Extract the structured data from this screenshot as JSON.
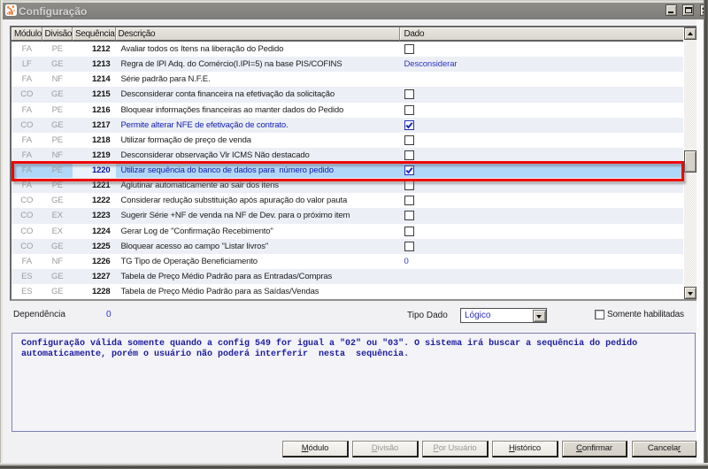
{
  "window": {
    "title": "Configuração",
    "window_buttons": [
      "minimize",
      "maximize",
      "close"
    ]
  },
  "table": {
    "columns": [
      "Módulo",
      "Divisão",
      "Sequência",
      "Descrição",
      "Dado"
    ],
    "rows": [
      {
        "module": "FA",
        "division": "PE",
        "sequence": "1212",
        "description": "Avaliar todos os Itens na liberação do Pedido",
        "dado_type": "checkbox",
        "dado_checked": false,
        "emphasis": false,
        "selected": false
      },
      {
        "module": "LF",
        "division": "GE",
        "sequence": "1213",
        "description": "Regra de IPI Adq. do Comércio(I.IPI=5) na base PIS/COFINS",
        "dado_type": "text",
        "dado_text": "Desconsiderar",
        "emphasis": false,
        "selected": false
      },
      {
        "module": "FA",
        "division": "NF",
        "sequence": "1214",
        "description": "Série padrão para N.F.E.",
        "dado_type": "none",
        "emphasis": false,
        "selected": false
      },
      {
        "module": "CO",
        "division": "GE",
        "sequence": "1215",
        "description": "Desconsiderar conta financeira na efetivação da solicitação",
        "dado_type": "checkbox",
        "dado_checked": false,
        "emphasis": false,
        "selected": false
      },
      {
        "module": "FA",
        "division": "PE",
        "sequence": "1216",
        "description": "Bloquear informações financeiras ao manter dados do Pedido",
        "dado_type": "checkbox",
        "dado_checked": false,
        "emphasis": false,
        "selected": false
      },
      {
        "module": "CO",
        "division": "GE",
        "sequence": "1217",
        "description": "Permite alterar NFE de efetivação de contrato.",
        "dado_type": "checkbox",
        "dado_checked": true,
        "emphasis": true,
        "selected": false
      },
      {
        "module": "FA",
        "division": "PE",
        "sequence": "1218",
        "description": "Utilizar formação de preço de venda",
        "dado_type": "checkbox",
        "dado_checked": false,
        "emphasis": false,
        "selected": false
      },
      {
        "module": "FA",
        "division": "NF",
        "sequence": "1219",
        "description": "Desconsiderar observação Vlr ICMS Não destacado",
        "dado_type": "checkbox",
        "dado_checked": false,
        "emphasis": false,
        "selected": false
      },
      {
        "module": "FA",
        "division": "PE",
        "sequence": "1220",
        "description": "Utilizar sequência do banco de dados para  número pedido",
        "dado_type": "checkbox",
        "dado_checked": true,
        "emphasis": false,
        "selected": true
      },
      {
        "module": "FA",
        "division": "PE",
        "sequence": "1221",
        "description": "Aglutinar automaticamente ao sair dos itens",
        "dado_type": "checkbox",
        "dado_checked": false,
        "emphasis": false,
        "selected": false
      },
      {
        "module": "CO",
        "division": "GE",
        "sequence": "1222",
        "description": "Considerar redução substituição após apuração do valor pauta",
        "dado_type": "checkbox",
        "dado_checked": false,
        "emphasis": false,
        "selected": false
      },
      {
        "module": "CO",
        "division": "EX",
        "sequence": "1223",
        "description": "Sugerir Série +NF de venda na NF de Dev. para o próximo item",
        "dado_type": "checkbox",
        "dado_checked": false,
        "emphasis": false,
        "selected": false
      },
      {
        "module": "CO",
        "division": "EX",
        "sequence": "1224",
        "description": "Gerar Log de \"Confirmação Recebimento\"",
        "dado_type": "checkbox",
        "dado_checked": false,
        "emphasis": false,
        "selected": false
      },
      {
        "module": "CO",
        "division": "GE",
        "sequence": "1225",
        "description": "Bloquear acesso ao campo \"Listar livros\"",
        "dado_type": "checkbox",
        "dado_checked": false,
        "emphasis": false,
        "selected": false
      },
      {
        "module": "FA",
        "division": "NF",
        "sequence": "1226",
        "description": "TG Tipo de Operação Beneficiamento",
        "dado_type": "text",
        "dado_text": "0",
        "emphasis": false,
        "selected": false
      },
      {
        "module": "ES",
        "division": "GE",
        "sequence": "1227",
        "description": "Tabela de Preço Médio Padrão para as Entradas/Compras",
        "dado_type": "none",
        "emphasis": false,
        "selected": false
      },
      {
        "module": "ES",
        "division": "GE",
        "sequence": "1228",
        "description": "Tabela de Preço Médio Padrão para as Saídas/Vendas",
        "dado_type": "none",
        "emphasis": false,
        "selected": false
      }
    ],
    "selected_sequence": "1220",
    "annotation_color": "#ee0606",
    "selected_row_color": "#b1d7f8"
  },
  "fields": {
    "dependencia_label": "Dependência",
    "dependencia_value": "0",
    "tipo_dado_label": "Tipo Dado",
    "tipo_dado_value": "Lógico",
    "somente_habilitadas_label": "Somente habilitadas",
    "somente_habilitadas_checked": false
  },
  "info_box": {
    "text": "Configuração válida somente quando a config 549 for igual a \"02\" ou \"03\". O sistema irá buscar a sequência do pedido\nautomaticamente, porém o usuário não poderá interferir  nesta  sequência."
  },
  "buttons": [
    {
      "label": "Módulo",
      "underline_index": 0,
      "enabled": true,
      "variant": "light"
    },
    {
      "label": "Divisão",
      "underline_index": 0,
      "enabled": false,
      "variant": "light"
    },
    {
      "label": "Por Usuário",
      "underline_index": 0,
      "enabled": false,
      "variant": "light"
    },
    {
      "label": "Histórico",
      "underline_index": 0,
      "enabled": true,
      "variant": "light"
    },
    {
      "label": "Confirmar",
      "underline_index": 0,
      "enabled": true,
      "variant": "gray"
    },
    {
      "label": "Cancelar",
      "underline_index": 7,
      "enabled": true,
      "variant": "gray"
    }
  ]
}
